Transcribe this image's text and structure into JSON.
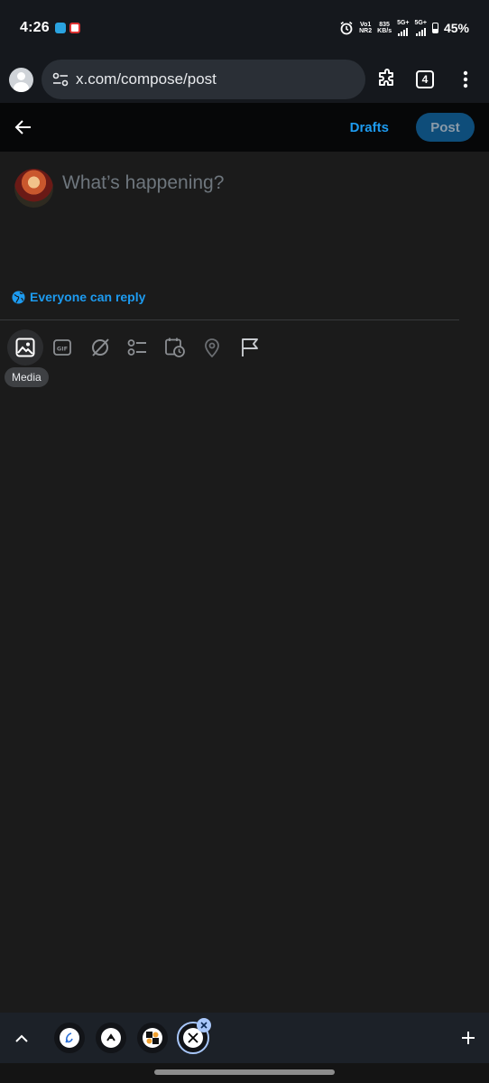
{
  "status_bar": {
    "time": "4:26",
    "net_volte": "Vo1",
    "net_nr": "NR2",
    "speed_value": "835",
    "speed_unit": "KB/s",
    "sim1": "5G+",
    "sim2": "5G+",
    "battery": "45%"
  },
  "browser": {
    "url": "x.com/compose/post",
    "tab_count": "4"
  },
  "compose": {
    "drafts_label": "Drafts",
    "post_label": "Post",
    "placeholder": "What’s happening?",
    "reply_setting": "Everyone can reply"
  },
  "toolbar": {
    "items": [
      "media-icon",
      "gif-icon",
      "grok-icon",
      "poll-icon",
      "schedule-icon",
      "location-icon",
      "flag-icon"
    ],
    "tooltip": "Media",
    "gif_text": "GIF"
  },
  "tab_strip": {
    "tabs": [
      "tab-1",
      "tab-2",
      "tab-3",
      "x-tab"
    ],
    "selected": "x-tab"
  },
  "colors": {
    "accent": "#1d9bf0",
    "background": "#1b1b1b",
    "post_button": "#0e4d7a"
  }
}
